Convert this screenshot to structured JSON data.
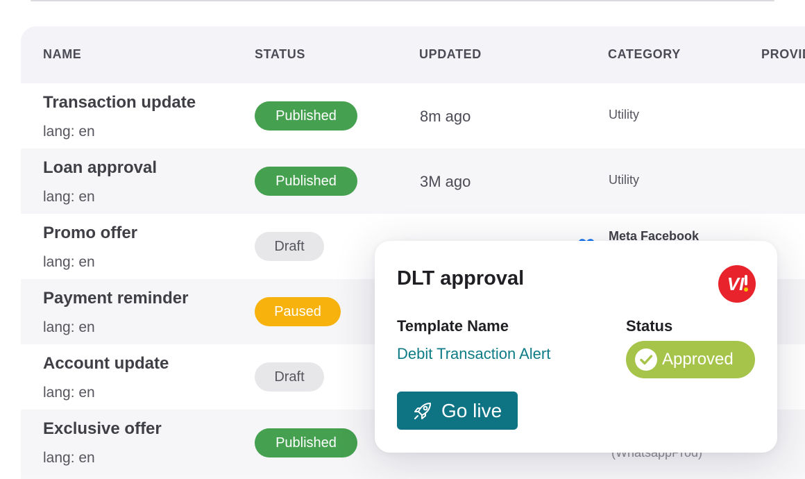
{
  "table": {
    "headers": {
      "name": "NAME",
      "status": "STATUS",
      "updated": "UPDATED",
      "category": "CATEGORY",
      "provider": "PROVID"
    },
    "rows": [
      {
        "name": "Transaction update",
        "lang": "lang: en",
        "status": "Published",
        "updated": "8m ago",
        "category": "Utility"
      },
      {
        "name": "Loan approval",
        "lang": "lang: en",
        "status": "Published",
        "updated": "3M ago",
        "category": "Utility"
      },
      {
        "name": "Promo offer",
        "lang": "lang: en",
        "status": "Draft",
        "category": "Meta Facebook"
      },
      {
        "name": "Payment reminder",
        "lang": "lang: en",
        "status": "Paused"
      },
      {
        "name": "Account update",
        "lang": "lang: en",
        "status": "Draft"
      },
      {
        "name": "Exclusive offer",
        "lang": "lang: en",
        "status": "Published",
        "category": "(WhatsappProd)"
      }
    ]
  },
  "popup": {
    "title": "DLT approval",
    "logo_text": "VI",
    "template_name_label": "Template Name",
    "template_name_value": "Debit Transaction Alert",
    "status_label": "Status",
    "status_value": "Approved",
    "action_label": "Go live"
  },
  "colors": {
    "published": "#45a04f",
    "draft": "#e7e7ea",
    "paused": "#f7b20d",
    "approved": "#a7c44a",
    "accent_teal": "#0e7484",
    "logo_red": "#e8232b"
  },
  "icons": {
    "check": "check-circle-icon",
    "rocket": "rocket-icon",
    "logo": "vi-logo-icon",
    "meta": "meta-icon"
  }
}
